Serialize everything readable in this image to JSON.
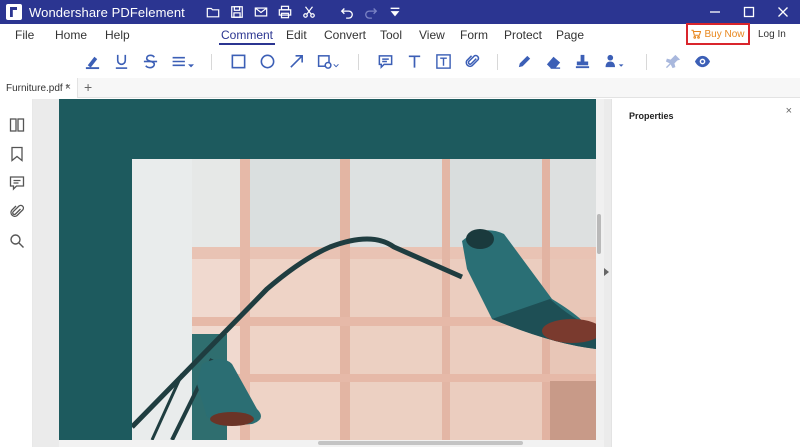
{
  "app": {
    "title": "Wondershare PDFelement"
  },
  "quick_access": [
    "folder-icon",
    "save-icon",
    "mail-icon",
    "print-icon",
    "scissors-icon",
    "undo-icon",
    "redo-icon",
    "dropdown-icon"
  ],
  "window_controls": [
    "minimize-icon",
    "maximize-icon",
    "close-icon"
  ],
  "menu": {
    "items": [
      "File",
      "Home",
      "Help",
      "Comment",
      "Edit",
      "Convert",
      "Tool",
      "View",
      "Form",
      "Protect",
      "Page"
    ],
    "active": "Comment",
    "buy_now": "Buy Now",
    "login": "Log In"
  },
  "toolbar": {
    "tools": [
      "highlight-icon",
      "underline-icon",
      "strikethrough-icon",
      "lines-dropdown-icon",
      "rectangle-icon",
      "oval-icon",
      "arrow-icon",
      "shapes-dropdown-icon",
      "note-icon",
      "text-icon",
      "textbox-icon",
      "attach-icon",
      "pencil-icon",
      "eraser-icon",
      "stamp-icon",
      "signature-dropdown-icon",
      "pin-icon",
      "eye-icon"
    ]
  },
  "tabs": [
    {
      "label": "Furniture.pdf *",
      "close": "×"
    }
  ],
  "tab_add": "+",
  "sidebar": {
    "icons": [
      "thumbnails-icon",
      "bookmark-icon",
      "comment-icon",
      "attachment-icon",
      "search-icon"
    ]
  },
  "properties": {
    "title": "Properties",
    "close": "×"
  },
  "colors": {
    "title_bar": "#2b3591",
    "accent": "#2b3591",
    "page_background": "#1d5a5e",
    "buy_now_border": "#d9252c",
    "buy_now_text": "#e8871e"
  }
}
